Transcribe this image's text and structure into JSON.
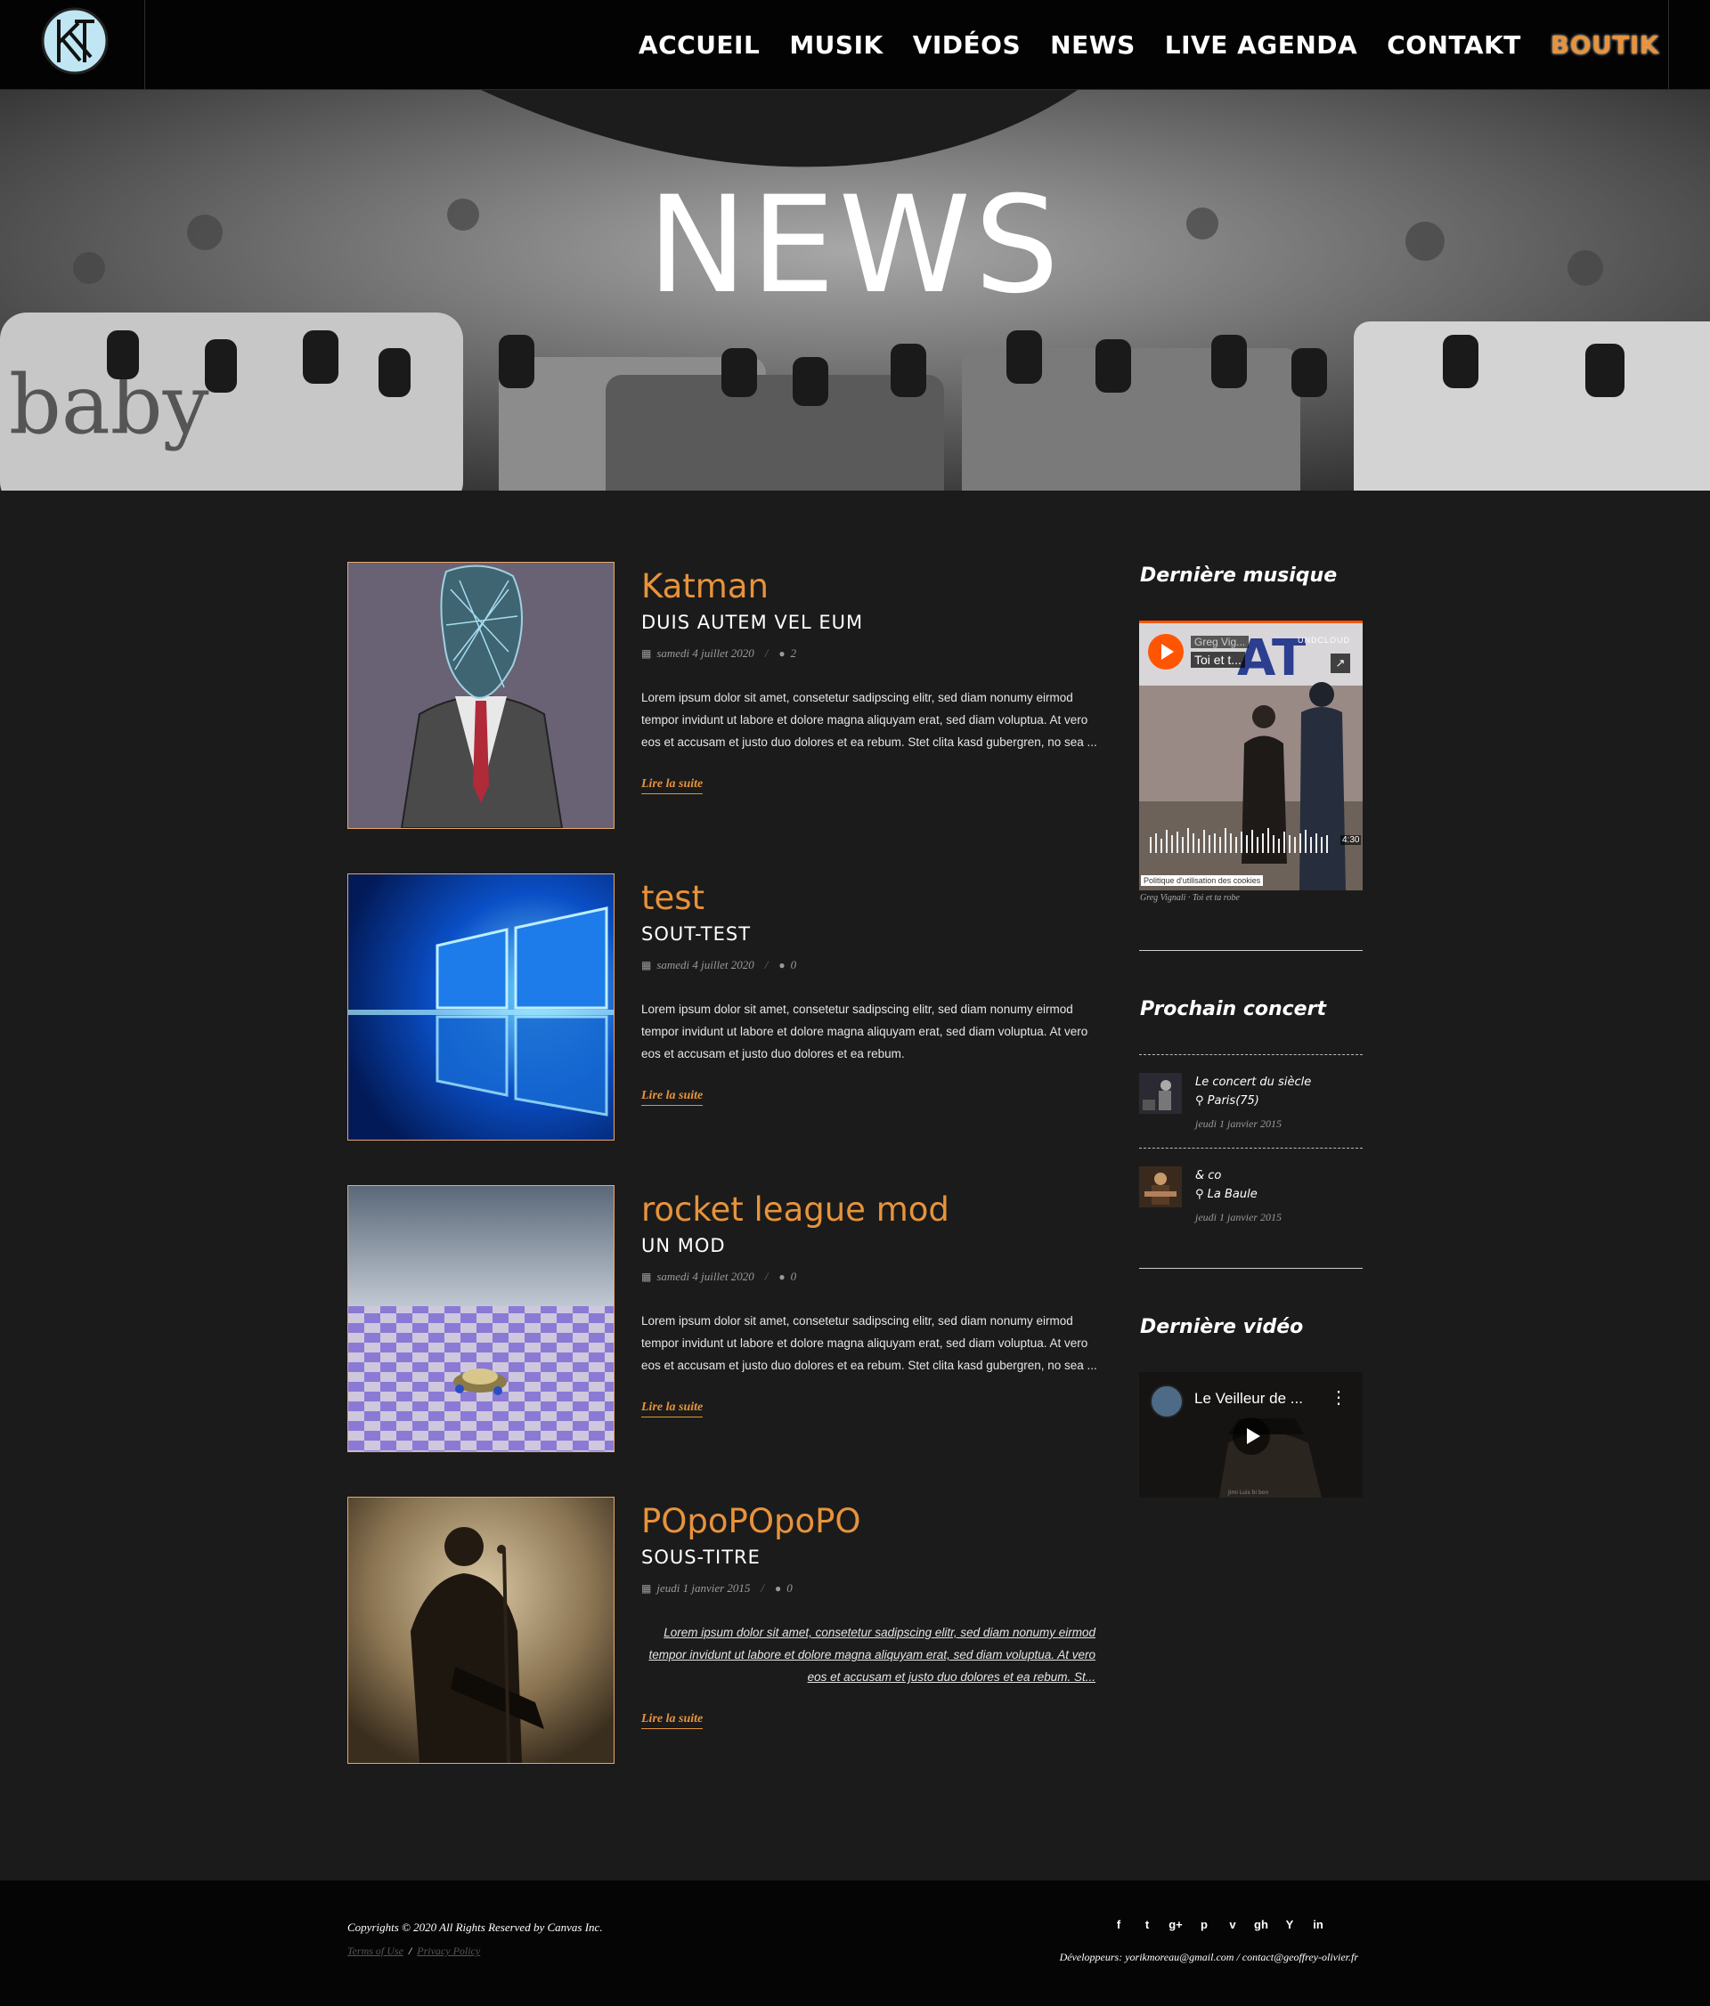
{
  "nav": {
    "items": [
      "ACCUEIL",
      "MUSIK",
      "VIDÉOS",
      "NEWS",
      "LIVE AGENDA",
      "CONTAKT"
    ],
    "shop": "BOUTIK"
  },
  "hero": {
    "title": "NEWS",
    "pedal_text": "baby"
  },
  "posts": [
    {
      "title": "Katman",
      "subtitle": "DUIS AUTEM VEL EUM",
      "date": "samedi 4 juillet 2020",
      "comments": "2",
      "excerpt": "Lorem ipsum dolor sit amet, consetetur sadipscing elitr, sed diam nonumy eirmod tempor invidunt ut labore et dolore magna aliquyam erat, sed diam voluptua. At vero eos et accusam et justo duo dolores et ea rebum. Stet clita kasd gubergren, no sea ...",
      "more": "Lire la suite"
    },
    {
      "title": "test",
      "subtitle": "SOUT-TEST",
      "date": "samedi 4 juillet 2020",
      "comments": "0",
      "excerpt": " Lorem ipsum dolor sit amet, consetetur sadipscing elitr, sed diam nonumy eirmod tempor invidunt ut labore et dolore magna aliquyam erat, sed diam voluptua. At vero eos et accusam et justo duo dolores et ea rebum.",
      "more": "Lire la suite"
    },
    {
      "title": "rocket league mod",
      "subtitle": "UN MOD",
      "date": "samedi 4 juillet 2020",
      "comments": "0",
      "excerpt": "Lorem ipsum dolor sit amet, consetetur sadipscing elitr, sed diam nonumy eirmod tempor invidunt ut labore et dolore magna aliquyam erat, sed diam voluptua. At vero eos et accusam et justo duo dolores et ea rebum. Stet clita kasd gubergren, no sea ...",
      "more": "Lire la suite"
    },
    {
      "title": "POpoPOpoPO",
      "subtitle": "SOUS-TITRE",
      "date": "jeudi 1 janvier 2015",
      "comments": "0",
      "excerpt": "Lorem ipsum dolor sit amet, consetetur sadipscing elitr, sed diam nonumy eirmod tempor invidunt ut labore et dolore magna aliquyam erat, sed diam voluptua. At vero eos et accusam et justo duo dolores et ea rebum. St...",
      "more": "Lire la suite"
    }
  ],
  "sidebar": {
    "music_heading": "Dernière musique",
    "soundcloud": {
      "artist": "Greg Vig...",
      "track": "Toi et t...",
      "brand": "UNDCLOUD",
      "duration": "4:30",
      "cookie": "Politique d'utilisation des cookies",
      "caption_artist": "Greg Vignali",
      "caption_sep": "·",
      "caption_track": "Toi et ta robe",
      "poster_text": "AT"
    },
    "concert_heading": "Prochain concert",
    "concerts": [
      {
        "name": "Le concert du siècle",
        "place": "Paris(75)",
        "date": "jeudi 1 janvier 2015"
      },
      {
        "name": "& co",
        "place": "La Baule",
        "date": "jeudi 1 janvier 2015"
      }
    ],
    "video_heading": "Dernière vidéo",
    "video": {
      "title": "Le Veilleur de ...",
      "menu": "⋮",
      "caption": "Jimi Luis bi bon"
    }
  },
  "footer": {
    "copyright": "Copyrights © 2020 All Rights Reserved by Canvas Inc.",
    "terms": "Terms of Use",
    "sep": "/",
    "privacy": "Privacy Policy",
    "social": [
      "f",
      "t",
      "g+",
      "p",
      "v",
      "gh",
      "Y",
      "in"
    ],
    "devs_label": "Développeurs:",
    "devs": "yorikmoreau@gmail.com  /  contact@geoffrey-olivier.fr"
  },
  "colors": {
    "accent": "#e7933b",
    "background": "#1b1b1b",
    "header": "#030303",
    "soundcloud": "#ff5500"
  }
}
